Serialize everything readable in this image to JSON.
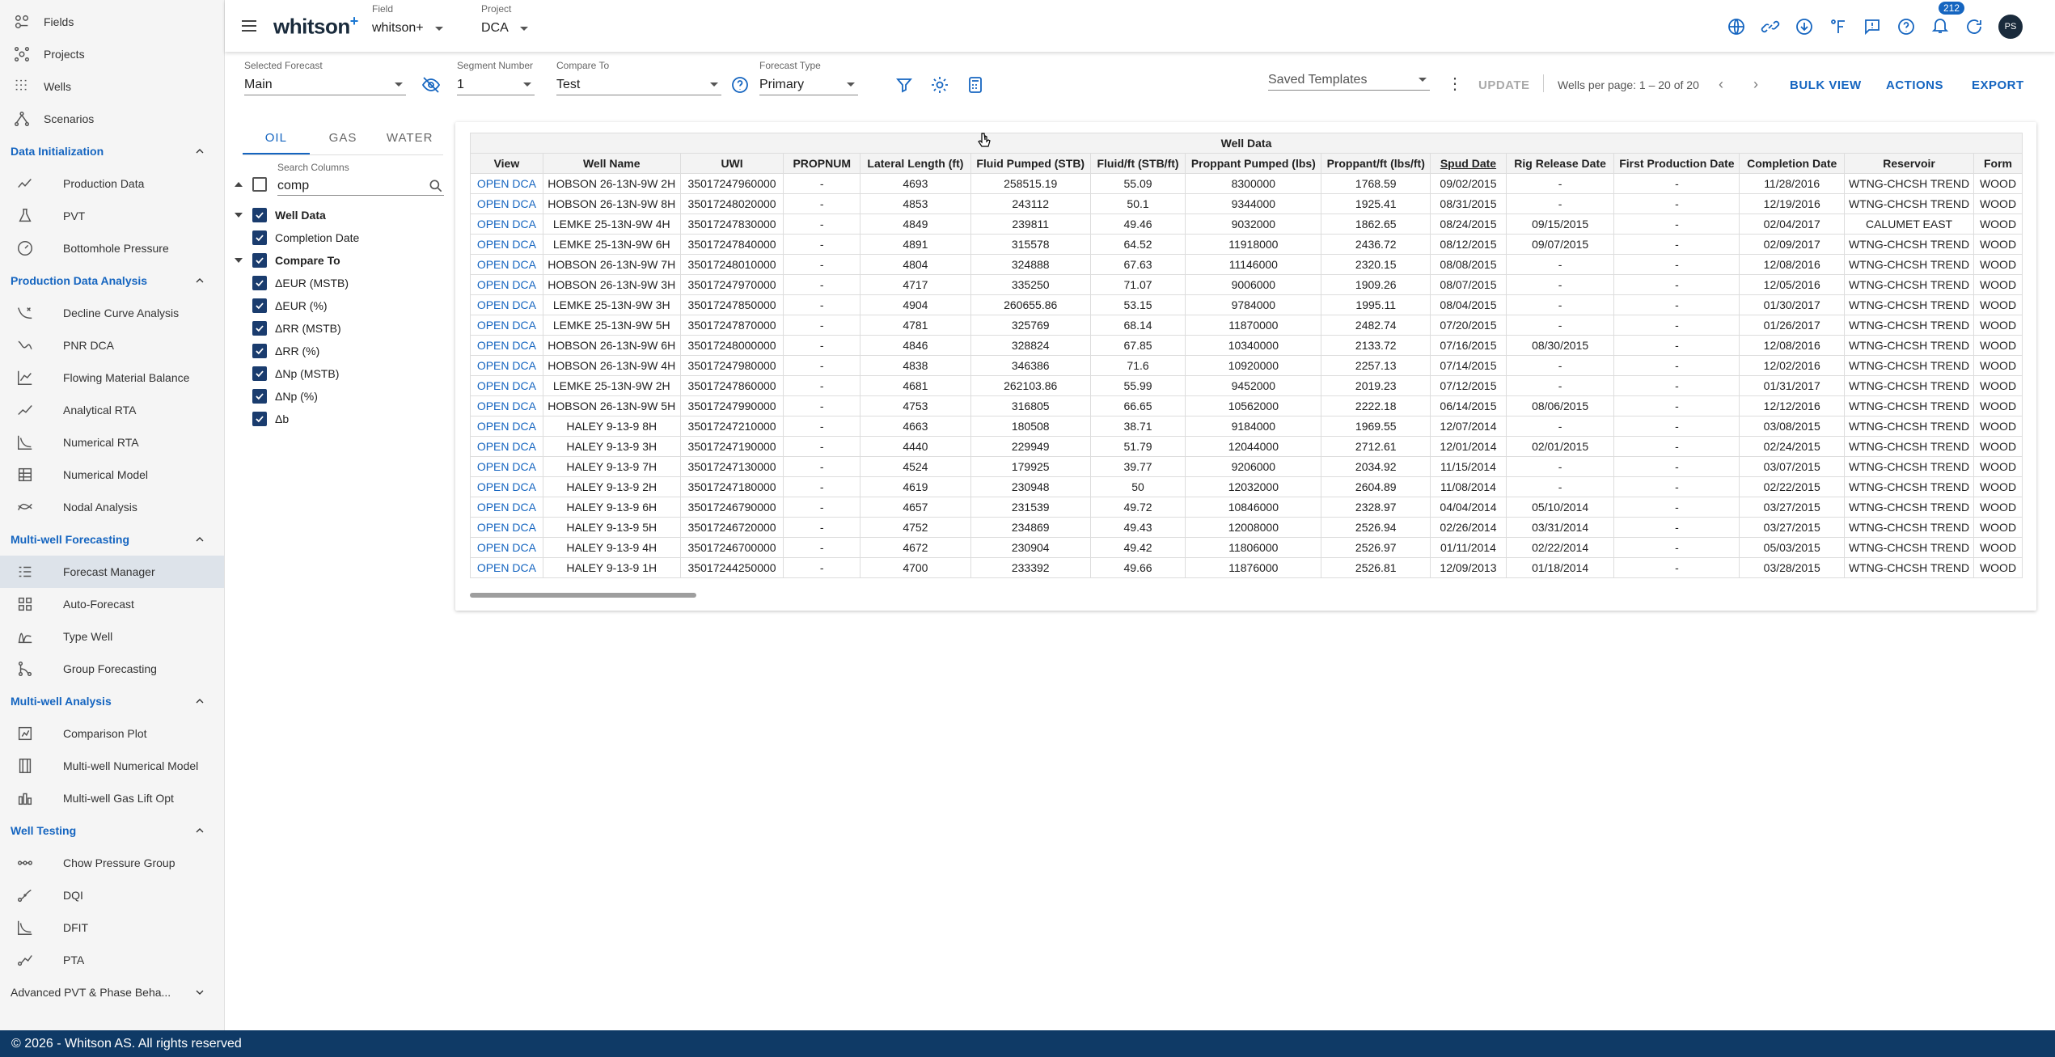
{
  "sidebar": {
    "top_items": [
      {
        "label": "Fields",
        "icon": "fields-icon"
      },
      {
        "label": "Projects",
        "icon": "projects-icon"
      },
      {
        "label": "Wells",
        "icon": "wells-icon"
      },
      {
        "label": "Scenarios",
        "icon": "scenarios-icon"
      }
    ],
    "sections": [
      {
        "title": "Data Initialization",
        "items": [
          {
            "label": "Production Data",
            "icon": "production-data-icon"
          },
          {
            "label": "PVT",
            "icon": "pvt-icon"
          },
          {
            "label": "Bottomhole Pressure",
            "icon": "bottomhole-pressure-icon"
          }
        ]
      },
      {
        "title": "Production Data Analysis",
        "items": [
          {
            "label": "Decline Curve Analysis",
            "icon": "decline-curve-icon"
          },
          {
            "label": "PNR DCA",
            "icon": "pnr-dca-icon"
          },
          {
            "label": "Flowing Material Balance",
            "icon": "fmb-icon"
          },
          {
            "label": "Analytical RTA",
            "icon": "analytical-rta-icon"
          },
          {
            "label": "Numerical RTA",
            "icon": "numerical-rta-icon"
          },
          {
            "label": "Numerical Model",
            "icon": "numerical-model-icon"
          },
          {
            "label": "Nodal Analysis",
            "icon": "nodal-analysis-icon"
          }
        ]
      },
      {
        "title": "Multi-well Forecasting",
        "items": [
          {
            "label": "Forecast Manager",
            "icon": "forecast-manager-icon",
            "active": true
          },
          {
            "label": "Auto-Forecast",
            "icon": "auto-forecast-icon"
          },
          {
            "label": "Type Well",
            "icon": "type-well-icon"
          },
          {
            "label": "Group Forecasting",
            "icon": "group-forecasting-icon"
          }
        ]
      },
      {
        "title": "Multi-well Analysis",
        "items": [
          {
            "label": "Comparison Plot",
            "icon": "comparison-plot-icon"
          },
          {
            "label": "Multi-well Numerical Model",
            "icon": "multiwell-numerical-icon"
          },
          {
            "label": "Multi-well Gas Lift Opt",
            "icon": "gas-lift-icon"
          }
        ]
      },
      {
        "title": "Well Testing",
        "items": [
          {
            "label": "Chow Pressure Group",
            "icon": "chow-pressure-icon"
          },
          {
            "label": "DQI",
            "icon": "dqi-icon"
          },
          {
            "label": "DFIT",
            "icon": "dfit-icon"
          },
          {
            "label": "PTA",
            "icon": "pta-icon"
          }
        ]
      }
    ],
    "collapsed_section": "Advanced PVT & Phase Beha..."
  },
  "footer": "© 2026 - Whitson AS. All rights reserved",
  "header": {
    "logo": "whitson",
    "logo_sup": "+",
    "field_label": "Field",
    "field_value": "whitson+",
    "project_label": "Project",
    "project_value": "DCA",
    "notification_count": "212",
    "avatar_initials": "PS"
  },
  "toolbar": {
    "selected_forecast_label": "Selected Forecast",
    "selected_forecast_value": "Main",
    "segment_number_label": "Segment Number",
    "segment_number_value": "1",
    "compare_to_label": "Compare To",
    "compare_to_value": "Test",
    "forecast_type_label": "Forecast Type",
    "forecast_type_value": "Primary",
    "saved_templates_placeholder": "Saved Templates",
    "update_label": "UPDATE",
    "pagination": "Wells per page: 1 – 20 of 20",
    "bulk_view_label": "BULK VIEW",
    "actions_label": "ACTIONS",
    "export_label": "EXPORT"
  },
  "panel": {
    "tabs": [
      "OIL",
      "GAS",
      "WATER"
    ],
    "search_label": "Search Columns",
    "search_value": "comp",
    "groups": [
      {
        "label": "Well Data",
        "children": [
          "Completion Date"
        ]
      },
      {
        "label": "Compare To",
        "children": [
          "ΔEUR (MSTB)",
          "ΔEUR (%)",
          "ΔRR (MSTB)",
          "ΔRR (%)",
          "ΔNp (MSTB)",
          "ΔNp (%)",
          "Δb"
        ]
      }
    ]
  },
  "table": {
    "group_header": "Well Data",
    "columns": [
      "View",
      "Well Name",
      "UWI",
      "PROPNUM",
      "Lateral Length (ft)",
      "Fluid Pumped (STB)",
      "Fluid/ft (STB/ft)",
      "Proppant Pumped (lbs)",
      "Proppant/ft (lbs/ft)",
      "Spud Date",
      "Rig Release Date",
      "First Production Date",
      "Completion Date",
      "Reservoir",
      "Form"
    ],
    "rows": [
      [
        "OPEN DCA",
        "HOBSON 26-13N-9W 2H",
        "35017247960000",
        "-",
        "4693",
        "258515.19",
        "55.09",
        "8300000",
        "1768.59",
        "09/02/2015",
        "-",
        "-",
        "11/28/2016",
        "WTNG-CHCSH TREND",
        "WOOD"
      ],
      [
        "OPEN DCA",
        "HOBSON 26-13N-9W 8H",
        "35017248020000",
        "-",
        "4853",
        "243112",
        "50.1",
        "9344000",
        "1925.41",
        "08/31/2015",
        "-",
        "-",
        "12/19/2016",
        "WTNG-CHCSH TREND",
        "WOOD"
      ],
      [
        "OPEN DCA",
        "LEMKE 25-13N-9W 4H",
        "35017247830000",
        "-",
        "4849",
        "239811",
        "49.46",
        "9032000",
        "1862.65",
        "08/24/2015",
        "09/15/2015",
        "-",
        "02/04/2017",
        "CALUMET EAST",
        "WOOD"
      ],
      [
        "OPEN DCA",
        "LEMKE 25-13N-9W 6H",
        "35017247840000",
        "-",
        "4891",
        "315578",
        "64.52",
        "11918000",
        "2436.72",
        "08/12/2015",
        "09/07/2015",
        "-",
        "02/09/2017",
        "WTNG-CHCSH TREND",
        "WOOD"
      ],
      [
        "OPEN DCA",
        "HOBSON 26-13N-9W 7H",
        "35017248010000",
        "-",
        "4804",
        "324888",
        "67.63",
        "11146000",
        "2320.15",
        "08/08/2015",
        "-",
        "-",
        "12/08/2016",
        "WTNG-CHCSH TREND",
        "WOOD"
      ],
      [
        "OPEN DCA",
        "HOBSON 26-13N-9W 3H",
        "35017247970000",
        "-",
        "4717",
        "335250",
        "71.07",
        "9006000",
        "1909.26",
        "08/07/2015",
        "-",
        "-",
        "12/05/2016",
        "WTNG-CHCSH TREND",
        "WOOD"
      ],
      [
        "OPEN DCA",
        "LEMKE 25-13N-9W 3H",
        "35017247850000",
        "-",
        "4904",
        "260655.86",
        "53.15",
        "9784000",
        "1995.11",
        "08/04/2015",
        "-",
        "-",
        "01/30/2017",
        "WTNG-CHCSH TREND",
        "WOOD"
      ],
      [
        "OPEN DCA",
        "LEMKE 25-13N-9W 5H",
        "35017247870000",
        "-",
        "4781",
        "325769",
        "68.14",
        "11870000",
        "2482.74",
        "07/20/2015",
        "-",
        "-",
        "01/26/2017",
        "WTNG-CHCSH TREND",
        "WOOD"
      ],
      [
        "OPEN DCA",
        "HOBSON 26-13N-9W 6H",
        "35017248000000",
        "-",
        "4846",
        "328824",
        "67.85",
        "10340000",
        "2133.72",
        "07/16/2015",
        "08/30/2015",
        "-",
        "12/08/2016",
        "WTNG-CHCSH TREND",
        "WOOD"
      ],
      [
        "OPEN DCA",
        "HOBSON 26-13N-9W 4H",
        "35017247980000",
        "-",
        "4838",
        "346386",
        "71.6",
        "10920000",
        "2257.13",
        "07/14/2015",
        "-",
        "-",
        "12/02/2016",
        "WTNG-CHCSH TREND",
        "WOOD"
      ],
      [
        "OPEN DCA",
        "LEMKE 25-13N-9W 2H",
        "35017247860000",
        "-",
        "4681",
        "262103.86",
        "55.99",
        "9452000",
        "2019.23",
        "07/12/2015",
        "-",
        "-",
        "01/31/2017",
        "WTNG-CHCSH TREND",
        "WOOD"
      ],
      [
        "OPEN DCA",
        "HOBSON 26-13N-9W 5H",
        "35017247990000",
        "-",
        "4753",
        "316805",
        "66.65",
        "10562000",
        "2222.18",
        "06/14/2015",
        "08/06/2015",
        "-",
        "12/12/2016",
        "WTNG-CHCSH TREND",
        "WOOD"
      ],
      [
        "OPEN DCA",
        "HALEY 9-13-9 8H",
        "35017247210000",
        "-",
        "4663",
        "180508",
        "38.71",
        "9184000",
        "1969.55",
        "12/07/2014",
        "-",
        "-",
        "03/08/2015",
        "WTNG-CHCSH TREND",
        "WOOD"
      ],
      [
        "OPEN DCA",
        "HALEY 9-13-9 3H",
        "35017247190000",
        "-",
        "4440",
        "229949",
        "51.79",
        "12044000",
        "2712.61",
        "12/01/2014",
        "02/01/2015",
        "-",
        "02/24/2015",
        "WTNG-CHCSH TREND",
        "WOOD"
      ],
      [
        "OPEN DCA",
        "HALEY 9-13-9 7H",
        "35017247130000",
        "-",
        "4524",
        "179925",
        "39.77",
        "9206000",
        "2034.92",
        "11/15/2014",
        "-",
        "-",
        "03/07/2015",
        "WTNG-CHCSH TREND",
        "WOOD"
      ],
      [
        "OPEN DCA",
        "HALEY 9-13-9 2H",
        "35017247180000",
        "-",
        "4619",
        "230948",
        "50",
        "12032000",
        "2604.89",
        "11/08/2014",
        "-",
        "-",
        "02/22/2015",
        "WTNG-CHCSH TREND",
        "WOOD"
      ],
      [
        "OPEN DCA",
        "HALEY 9-13-9 6H",
        "35017246790000",
        "-",
        "4657",
        "231539",
        "49.72",
        "10846000",
        "2328.97",
        "04/04/2014",
        "05/10/2014",
        "-",
        "03/27/2015",
        "WTNG-CHCSH TREND",
        "WOOD"
      ],
      [
        "OPEN DCA",
        "HALEY 9-13-9 5H",
        "35017246720000",
        "-",
        "4752",
        "234869",
        "49.43",
        "12008000",
        "2526.94",
        "02/26/2014",
        "03/31/2014",
        "-",
        "03/27/2015",
        "WTNG-CHCSH TREND",
        "WOOD"
      ],
      [
        "OPEN DCA",
        "HALEY 9-13-9 4H",
        "35017246700000",
        "-",
        "4672",
        "230904",
        "49.42",
        "11806000",
        "2526.97",
        "01/11/2014",
        "02/22/2014",
        "-",
        "05/03/2015",
        "WTNG-CHCSH TREND",
        "WOOD"
      ],
      [
        "OPEN DCA",
        "HALEY 9-13-9 1H",
        "35017244250000",
        "-",
        "4700",
        "233392",
        "49.66",
        "11876000",
        "2526.81",
        "12/09/2013",
        "01/18/2014",
        "-",
        "03/28/2015",
        "WTNG-CHCSH TREND",
        "WOOD"
      ]
    ]
  }
}
